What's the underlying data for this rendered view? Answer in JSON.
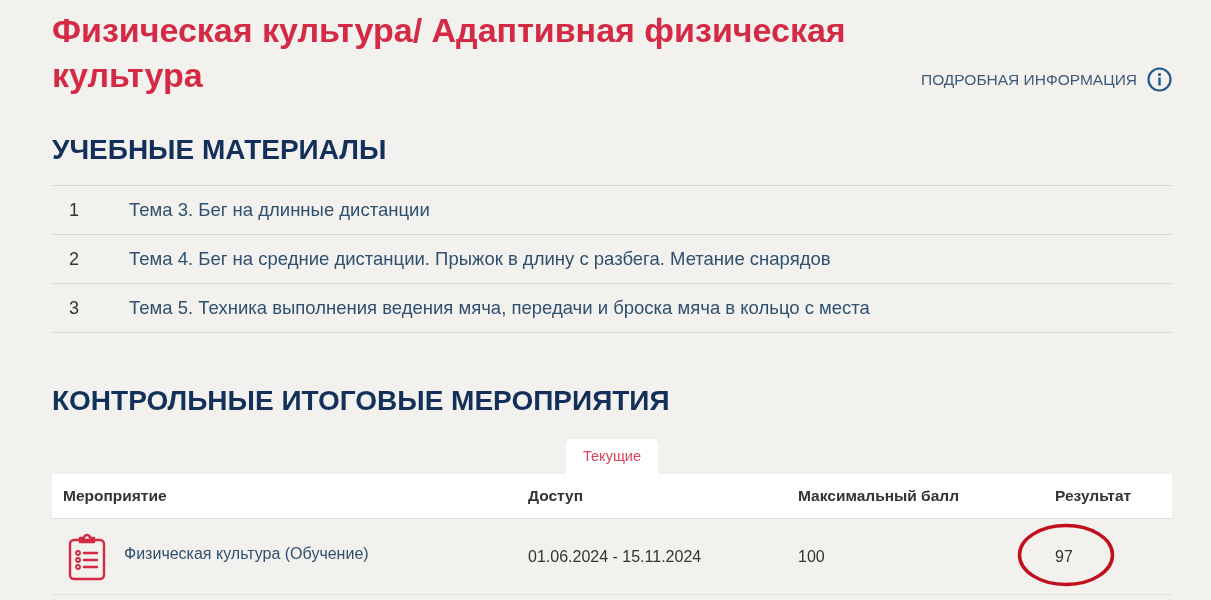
{
  "title": "Физическая культура/ Адаптивная физическая культура",
  "info_link": {
    "label": "ПОДРОБНАЯ ИНФОРМАЦИЯ"
  },
  "materials": {
    "heading": "УЧЕБНЫЕ МАТЕРИАЛЫ",
    "items": [
      {
        "number": "1",
        "title": "Тема 3. Бег на длинные дистанции"
      },
      {
        "number": "2",
        "title": "Тема 4. Бег на средние дистанции. Прыжок в длину с разбега. Метание снарядов"
      },
      {
        "number": "3",
        "title": "Тема 5. Техника выполнения ведения мяча, передачи и броска мяча в кольцо с места"
      }
    ]
  },
  "assessments": {
    "heading": "КОНТРОЛЬНЫЕ ИТОГОВЫЕ МЕРОПРИЯТИЯ",
    "tabs": [
      {
        "label": "Текущие",
        "selected": true
      }
    ],
    "table": {
      "columns": [
        "Мероприятие",
        "Доступ",
        "Максимальный балл",
        "Результат"
      ],
      "rows": [
        {
          "event": "Физическая культура (Обучение)",
          "access": "01.06.2024 - 15.11.2024",
          "max_score": "100",
          "result": "97",
          "circled": true
        }
      ]
    }
  }
}
